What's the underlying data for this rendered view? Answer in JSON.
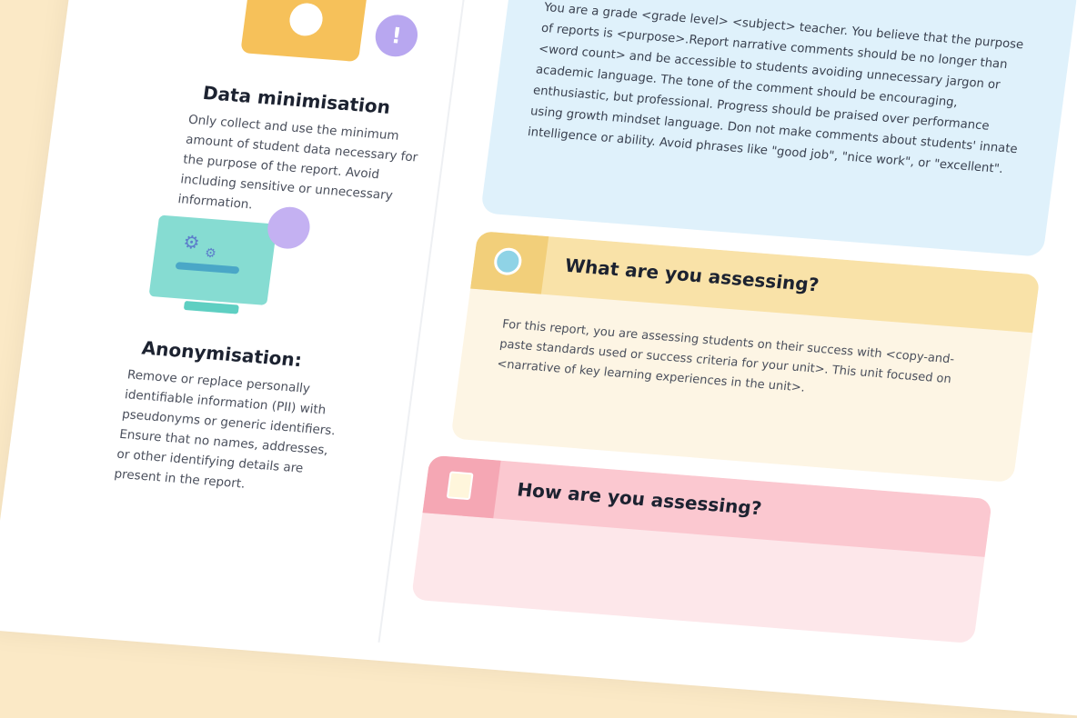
{
  "left": {
    "data_min": {
      "title": "Data minimisation",
      "body": "Only collect and use the minimum amount of student data necessary for the purpose of the report. Avoid including sensitive or unnecessary information."
    },
    "anon": {
      "title": "Anonymisation:",
      "body": "Remove or replace personally identifiable information (PII) with pseudonyms or generic identifiers. Ensure that no names, addresses, or other identifying details are present in the report."
    },
    "warn_icon": "warning-icon",
    "lock_icon": "lock-icon"
  },
  "right": {
    "prompt": "You are a grade <grade level> <subject> teacher. You believe that the purpose of reports is <purpose>.Report narrative comments should be no longer than <word count> and be accessible to students avoiding unnecessary jargon or academic language. The tone of the comment should be encouraging, enthusiastic, but professional. Progress should be praised over performance using growth mindset language. Don not make comments about students' innate intelligence or ability. Avoid phrases like \"good job\", \"nice work\", or \"excellent\".",
    "assess_card": {
      "title": "What are you assessing?",
      "body": "For this report, you are assessing students on their success with <copy-and-paste standards used or success criteria for your unit>. This unit focused on <narrative of key learning experiences in the unit>."
    },
    "how_card": {
      "title": "How are you assessing?"
    }
  },
  "colors": {
    "background": "#fbe9c6",
    "prompt_bg": "#dff1fb",
    "assess_header": "#f9e2a8",
    "how_header": "#fbc8d0"
  }
}
